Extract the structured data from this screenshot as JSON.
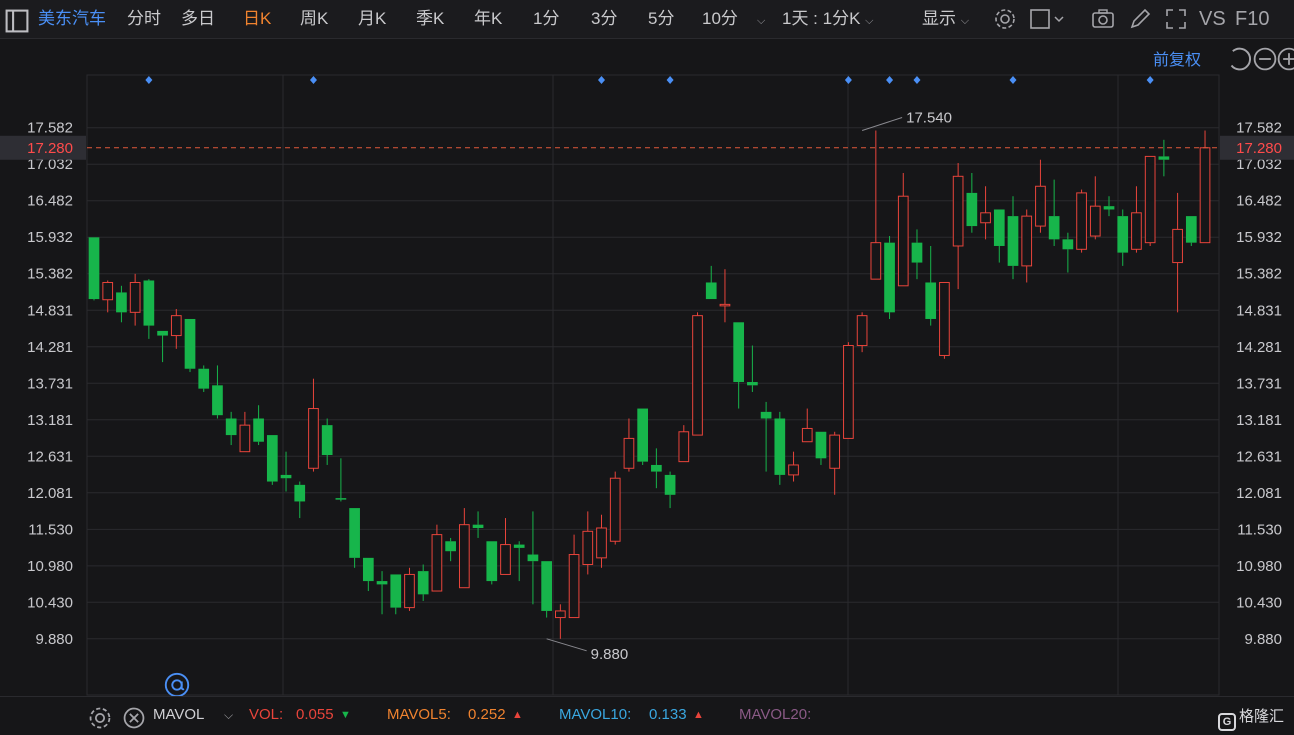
{
  "topbar": {
    "stock_name": "美东汽车",
    "tabs": [
      {
        "label": "分时",
        "active": false
      },
      {
        "label": "多日",
        "active": false
      },
      {
        "label": "日K",
        "active": true
      },
      {
        "label": "周K",
        "active": false
      },
      {
        "label": "月K",
        "active": false
      },
      {
        "label": "季K",
        "active": false
      },
      {
        "label": "年K",
        "active": false
      },
      {
        "label": "1分",
        "active": false
      },
      {
        "label": "3分",
        "active": false
      },
      {
        "label": "5分",
        "active": false
      },
      {
        "label": "10分",
        "active": false
      }
    ],
    "period_select": "1天 : 1分K",
    "display_label": "显示",
    "vs_label": "VS",
    "f10_label": "F10"
  },
  "subbar": {
    "adjust_label": "前复权"
  },
  "chart_data": {
    "type": "candlestick",
    "price_ticks": [
      17.582,
      17.032,
      16.482,
      15.932,
      15.382,
      14.831,
      14.281,
      13.731,
      13.181,
      12.631,
      12.081,
      11.53,
      10.98,
      10.43,
      9.88
    ],
    "price_tick_labels": [
      "17.582",
      "17.032",
      "16.482",
      "15.932",
      "15.382",
      "14.831",
      "14.281",
      "13.731",
      "13.181",
      "12.631",
      "12.081",
      "11.530",
      "10.980",
      "10.430",
      "9.880"
    ],
    "ylim": [
      9.44,
      18.0
    ],
    "current_price": 17.28,
    "current_price_label": "17.280",
    "max_label": "17.540",
    "max_value": 17.54,
    "max_index": 56,
    "min_label": "9.880",
    "min_value": 9.88,
    "min_index": 33,
    "event_marker_indices": [
      4,
      16,
      37,
      42,
      55,
      58,
      60,
      67,
      77
    ],
    "candles": [
      [
        15.93,
        15.0,
        15.93,
        14.98
      ],
      [
        14.99,
        15.25,
        15.28,
        14.8
      ],
      [
        15.1,
        14.8,
        15.2,
        14.65
      ],
      [
        14.8,
        15.25,
        15.38,
        14.6
      ],
      [
        15.28,
        14.6,
        15.3,
        14.4
      ],
      [
        14.52,
        14.45,
        14.52,
        14.05
      ],
      [
        14.45,
        14.75,
        14.85,
        14.25
      ],
      [
        14.7,
        13.95,
        14.7,
        13.9
      ],
      [
        13.95,
        13.65,
        14.0,
        13.6
      ],
      [
        13.7,
        13.25,
        14.0,
        13.2
      ],
      [
        13.2,
        12.95,
        13.3,
        12.8
      ],
      [
        12.7,
        13.1,
        13.3,
        12.7
      ],
      [
        13.2,
        12.85,
        13.4,
        12.8
      ],
      [
        12.95,
        12.25,
        12.95,
        12.2
      ],
      [
        12.35,
        12.3,
        12.7,
        12.1
      ],
      [
        12.2,
        11.95,
        12.25,
        11.7
      ],
      [
        12.45,
        13.35,
        13.8,
        12.4
      ],
      [
        13.1,
        12.65,
        13.2,
        12.5
      ],
      [
        12.0,
        11.98,
        12.6,
        11.95
      ],
      [
        11.85,
        11.1,
        11.85,
        10.95
      ],
      [
        11.1,
        10.75,
        11.1,
        10.6
      ],
      [
        10.75,
        10.7,
        10.9,
        10.25
      ],
      [
        10.85,
        10.35,
        10.85,
        10.25
      ],
      [
        10.35,
        10.85,
        10.95,
        10.3
      ],
      [
        10.9,
        10.55,
        11.0,
        10.45
      ],
      [
        10.6,
        11.45,
        11.6,
        10.6
      ],
      [
        11.35,
        11.2,
        11.4,
        11.05
      ],
      [
        10.65,
        11.6,
        11.85,
        10.65
      ],
      [
        11.6,
        11.55,
        11.8,
        11.4
      ],
      [
        11.35,
        10.75,
        11.35,
        10.7
      ],
      [
        10.85,
        11.3,
        11.7,
        10.85
      ],
      [
        11.3,
        11.25,
        11.35,
        10.75
      ],
      [
        11.15,
        11.05,
        11.8,
        10.4
      ],
      [
        11.05,
        10.3,
        11.05,
        10.2
      ],
      [
        10.2,
        10.3,
        10.4,
        9.88
      ],
      [
        10.2,
        11.15,
        11.45,
        10.2
      ],
      [
        11.0,
        11.5,
        11.8,
        10.85
      ],
      [
        11.1,
        11.55,
        11.75,
        10.95
      ],
      [
        11.35,
        12.3,
        12.4,
        11.3
      ],
      [
        12.45,
        12.9,
        13.2,
        12.4
      ],
      [
        13.35,
        12.55,
        13.35,
        12.5
      ],
      [
        12.5,
        12.4,
        12.75,
        12.15
      ],
      [
        12.35,
        12.05,
        12.4,
        11.85
      ],
      [
        12.55,
        13.0,
        13.1,
        12.55
      ],
      [
        12.95,
        14.75,
        14.8,
        12.95
      ],
      [
        15.25,
        15.0,
        15.5,
        15.0
      ],
      [
        14.92,
        14.92,
        15.45,
        14.65
      ],
      [
        14.65,
        13.75,
        14.65,
        13.35
      ],
      [
        13.75,
        13.7,
        14.3,
        13.6
      ],
      [
        13.3,
        13.2,
        13.45,
        12.4
      ],
      [
        13.2,
        12.35,
        13.3,
        12.2
      ],
      [
        12.35,
        12.5,
        12.7,
        12.25
      ],
      [
        12.85,
        13.05,
        13.35,
        12.85
      ],
      [
        13.0,
        12.6,
        13.0,
        12.5
      ],
      [
        12.45,
        12.95,
        13.0,
        12.05
      ],
      [
        12.9,
        14.3,
        14.35,
        12.9
      ],
      [
        14.3,
        14.75,
        14.8,
        14.2
      ],
      [
        15.3,
        15.85,
        17.54,
        15.3
      ],
      [
        15.85,
        14.8,
        15.95,
        14.7
      ],
      [
        15.2,
        16.55,
        16.9,
        15.2
      ],
      [
        15.85,
        15.55,
        16.05,
        15.3
      ],
      [
        15.25,
        14.7,
        15.8,
        14.6
      ],
      [
        14.15,
        15.25,
        15.25,
        14.1
      ],
      [
        15.8,
        16.85,
        17.05,
        15.15
      ],
      [
        16.6,
        16.1,
        16.9,
        16.0
      ],
      [
        16.15,
        16.3,
        16.7,
        15.9
      ],
      [
        16.35,
        15.8,
        16.35,
        15.55
      ],
      [
        16.25,
        15.5,
        16.55,
        15.3
      ],
      [
        15.5,
        16.25,
        16.35,
        15.25
      ],
      [
        16.1,
        16.7,
        17.1,
        16.0
      ],
      [
        16.25,
        15.9,
        16.8,
        15.8
      ],
      [
        15.9,
        15.75,
        16.0,
        15.4
      ],
      [
        15.75,
        16.6,
        16.65,
        15.7
      ],
      [
        15.95,
        16.4,
        16.85,
        15.9
      ],
      [
        16.4,
        16.35,
        16.55,
        16.25
      ],
      [
        16.25,
        15.7,
        16.35,
        15.5
      ],
      [
        15.75,
        16.3,
        16.7,
        15.7
      ],
      [
        15.85,
        17.15,
        17.15,
        15.8
      ],
      [
        17.15,
        17.1,
        17.4,
        16.85
      ],
      [
        15.55,
        16.05,
        16.6,
        14.8
      ],
      [
        16.25,
        15.85,
        16.25,
        15.8
      ],
      [
        15.85,
        17.28,
        17.54,
        15.85
      ]
    ]
  },
  "bottombar": {
    "indicator_name": "MAVOL",
    "vol_label": "VOL:",
    "vol_value": "0.055",
    "mavol5_label": "MAVOL5:",
    "mavol5_value": "0.252",
    "mavol10_label": "MAVOL10:",
    "mavol10_value": "0.133",
    "mavol20_label": "MAVOL20:",
    "logo_text": "格隆汇"
  },
  "colors": {
    "up": "#e8443b",
    "down": "#17b54b",
    "accent": "#f0832f",
    "link": "#4a8ff5",
    "grid": "#2a2a2e",
    "dash": "#e0593a"
  }
}
